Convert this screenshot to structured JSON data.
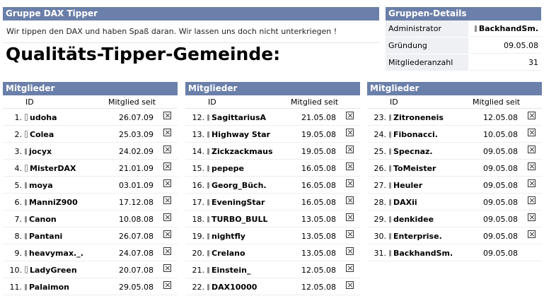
{
  "group": {
    "title": "Gruppe DAX Tipper",
    "description": "Wir tippen den DAX und haben Spaß daran. Wir lassen uns doch nicht unterkriegen !",
    "headline": "Qualitäts-Tipper-Gemeinde:"
  },
  "details": {
    "title": "Gruppen-Details",
    "rows": [
      {
        "label": "Administrator",
        "value": "BackhandSm.",
        "icon": "phone-icon"
      },
      {
        "label": "Gründung",
        "value": "09.05.08"
      },
      {
        "label": "Mitgliederanzahl",
        "value": "31"
      }
    ]
  },
  "members_title": "Mitglieder",
  "columns": {
    "id": "ID",
    "since": "Mitglied seit"
  },
  "members": [
    {
      "num": "1.",
      "name": "udoha",
      "date": "26.07.09",
      "icon": "hollow"
    },
    {
      "num": "2.",
      "name": "Colea",
      "date": "25.03.09",
      "icon": "hollow"
    },
    {
      "num": "3.",
      "name": "jocyx",
      "date": "24.02.09",
      "icon": "filled"
    },
    {
      "num": "4.",
      "name": "MisterDAX",
      "date": "21.01.09",
      "icon": "hollow"
    },
    {
      "num": "5.",
      "name": "moya",
      "date": "03.01.09",
      "icon": "filled"
    },
    {
      "num": "6.",
      "name": "ManniZ900",
      "date": "17.12.08",
      "icon": "filled"
    },
    {
      "num": "7.",
      "name": "Canon",
      "date": "10.08.08",
      "icon": "filled"
    },
    {
      "num": "8.",
      "name": "Pantani",
      "date": "26.07.08",
      "icon": "filled"
    },
    {
      "num": "9.",
      "name": "heavymax._.",
      "date": "24.07.08",
      "icon": "filled"
    },
    {
      "num": "10.",
      "name": "LadyGreen",
      "date": "20.07.08",
      "icon": "hollow"
    },
    {
      "num": "11.",
      "name": "Palaimon",
      "date": "29.05.08",
      "icon": "filled"
    },
    {
      "num": "12.",
      "name": "SagittariusA",
      "date": "21.05.08",
      "icon": "filled"
    },
    {
      "num": "13.",
      "name": "Highway Star",
      "date": "19.05.08",
      "icon": "filled"
    },
    {
      "num": "14.",
      "name": "Zickzackmaus",
      "date": "19.05.08",
      "icon": "filled"
    },
    {
      "num": "15.",
      "name": "pepepe",
      "date": "16.05.08",
      "icon": "filled"
    },
    {
      "num": "16.",
      "name": "Georg_Büch.",
      "date": "16.05.08",
      "icon": "filled"
    },
    {
      "num": "17.",
      "name": "EveningStar",
      "date": "16.05.08",
      "icon": "filled"
    },
    {
      "num": "18.",
      "name": "TURBO_BULL",
      "date": "13.05.08",
      "icon": "filled"
    },
    {
      "num": "19.",
      "name": "nightfly",
      "date": "13.05.08",
      "icon": "filled"
    },
    {
      "num": "20.",
      "name": "Crelano",
      "date": "13.05.08",
      "icon": "filled"
    },
    {
      "num": "21.",
      "name": "Einstein_",
      "date": "12.05.08",
      "icon": "filled"
    },
    {
      "num": "22.",
      "name": "DAX10000",
      "date": "12.05.08",
      "icon": "filled"
    },
    {
      "num": "23.",
      "name": "Zitroneneis",
      "date": "12.05.08",
      "icon": "filled"
    },
    {
      "num": "24.",
      "name": "Fibonacci.",
      "date": "10.05.08",
      "icon": "filled"
    },
    {
      "num": "25.",
      "name": "Specnaz.",
      "date": "09.05.08",
      "icon": "filled"
    },
    {
      "num": "26.",
      "name": "ToMeister",
      "date": "09.05.08",
      "icon": "filled"
    },
    {
      "num": "27.",
      "name": "Heuler",
      "date": "09.05.08",
      "icon": "filled"
    },
    {
      "num": "28.",
      "name": "DAXii",
      "date": "09.05.08",
      "icon": "filled"
    },
    {
      "num": "29.",
      "name": "denkidee",
      "date": "09.05.08",
      "icon": "filled"
    },
    {
      "num": "30.",
      "name": "Enterprise.",
      "date": "09.05.08",
      "icon": "filled"
    },
    {
      "num": "31.",
      "name": "BackhandSm.",
      "date": "09.05.08",
      "icon": "filled",
      "no_remove": true
    }
  ],
  "colors": {
    "header_bg": "#6a7fa9",
    "label_bg": "#eef0f4"
  }
}
